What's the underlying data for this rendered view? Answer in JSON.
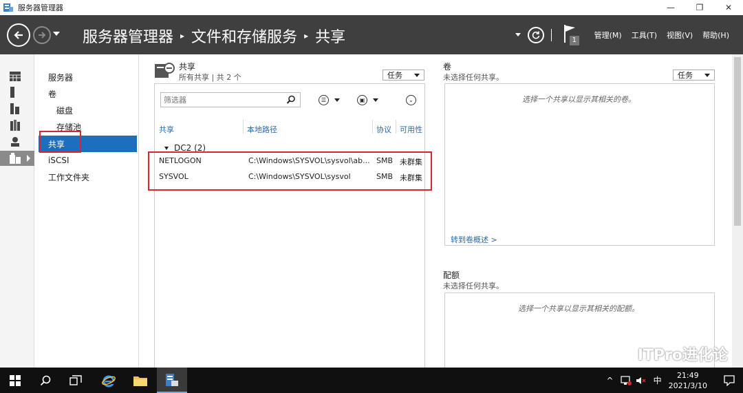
{
  "window": {
    "title": "服务器管理器",
    "minimize": "—",
    "restore": "❐",
    "close": "✕"
  },
  "header": {
    "breadcrumb": [
      "服务器管理器",
      "文件和存储服务",
      "共享"
    ],
    "menus": [
      "管理(M)",
      "工具(T)",
      "视图(V)",
      "帮助(H)"
    ],
    "flag_badge": "1"
  },
  "subnav": {
    "items": [
      {
        "label": "服务器",
        "level": 0
      },
      {
        "label": "卷",
        "level": 0
      },
      {
        "label": "磁盘",
        "level": 1
      },
      {
        "label": "存储池",
        "level": 1
      },
      {
        "label": "共享",
        "level": 0,
        "selected": true
      },
      {
        "label": "iSCSI",
        "level": 0
      },
      {
        "label": "工作文件夹",
        "level": 0
      }
    ]
  },
  "shares": {
    "title": "共享",
    "subtitle": "所有共享 | 共 2 个",
    "task_label": "任务",
    "filter_placeholder": "筛选器",
    "columns": [
      "共享",
      "本地路径",
      "协议",
      "可用性"
    ],
    "group": "DC2 (2)",
    "rows": [
      {
        "share": "NETLOGON",
        "path": "C:\\Windows\\SYSVOL\\sysvol\\ab...",
        "protocol": "SMB",
        "availability": "未群集"
      },
      {
        "share": "SYSVOL",
        "path": "C:\\Windows\\SYSVOL\\sysvol",
        "protocol": "SMB",
        "availability": "未群集"
      }
    ]
  },
  "volume": {
    "title": "卷",
    "subtitle": "未选择任何共享。",
    "task_label": "任务",
    "message": "选择一个共享以显示其相关的卷。",
    "link": "转到卷概述 >"
  },
  "quota": {
    "title": "配额",
    "subtitle": "未选择任何共享。",
    "message": "选择一个共享以显示其相关的配额。"
  },
  "watermark": "ITPro进化论",
  "taskbar": {
    "time": "21:49",
    "date": "2021/3/10",
    "ime": "中"
  }
}
